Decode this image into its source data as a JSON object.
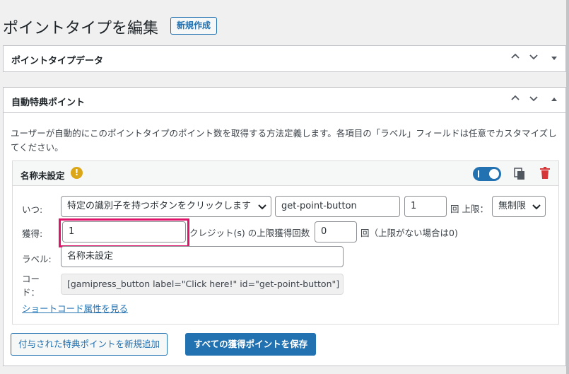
{
  "header": {
    "title": "ポイントタイプを編集",
    "add_new": "新規作成"
  },
  "box1": {
    "title": "ポイントタイプデータ"
  },
  "box2": {
    "title": "自動特典ポイント",
    "description": "ユーザーが自動的にこのポイントタイプのポイント数を取得する方法定義します。各項目の「ラベル」フィールドは任意でカスタマイズしてください。"
  },
  "requirement": {
    "title": "名称未設定",
    "when_label": "いつ:",
    "trigger_value": "特定の識別子を持つボタンをクリックします",
    "id_value": "get-point-button",
    "count_value": "1",
    "limit_label": "回 上限：",
    "limit_value": "無制限",
    "earn_label": "獲得:",
    "points_value": "1",
    "credits_label": "クレジット(s) の上限獲得回数",
    "max_value": "0",
    "max_suffix": "回（上限がない場合は0)",
    "label_label": "ラベル:",
    "label_value": "名称未設定",
    "code_label_1": "コー",
    "code_label_2": "ド：",
    "code_value": "[gamipress_button label=\"Click here!\" id=\"get-point-button\"]",
    "shortcode_link": "ショートコード属性を見る"
  },
  "actions": {
    "add_new": "付与された特典ポイントを新規追加",
    "save_all": "すべての獲得ポイントを保存"
  },
  "colors": {
    "accent": "#2271b1",
    "highlight": "#e0136a",
    "warning": "#dba617",
    "delete": "#d63638"
  }
}
